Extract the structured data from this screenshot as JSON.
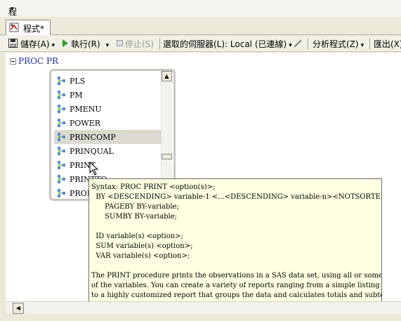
{
  "menu": {
    "label": "程式",
    "caret": "▾"
  },
  "tab": {
    "label": "程式*"
  },
  "toolbar": {
    "save": "儲存(A)",
    "run": "執行(R)",
    "stop": "停止(S)",
    "server": "選取的伺服器(L): Local (已連線)",
    "analyze": "分析程式(Z)",
    "export": "匯出(X)"
  },
  "editor": {
    "code": "PROC PR"
  },
  "autocomplete": {
    "items": [
      {
        "label": "PLS"
      },
      {
        "label": "PM"
      },
      {
        "label": "PMENU"
      },
      {
        "label": "POWER"
      },
      {
        "label": "PRINCOMP",
        "selected": true
      },
      {
        "label": "PRINQUAL"
      },
      {
        "label": "PRINT"
      },
      {
        "label": "PRINTTO"
      },
      {
        "label": "PROBIT"
      }
    ]
  },
  "tooltip": {
    "text": "Syntax: PROC PRINT <option(s)>;\n  BY <DESCENDING> variable-1 <...<DESCENDING> variable-n><NOTSORTED>;\n      PAGEBY BY-variable;\n      SUMBY BY-variable;\n\n  ID variable(s) <option>;\n  SUM variable(s) <option>;\n  VAR variable(s) <option>;\n\nThe PRINT procedure prints the observations in a SAS data set, using all or some\nof the variables. You can create a variety of reports ranging from a simple listing\nto a highly customized report that groups the data and calculates totals and subtotals\nfor numeric variables."
  },
  "colors": {
    "code": "#1f2fa8",
    "tooltip_bg": "#ffffe1",
    "selected_bg": "#dcd9d1"
  },
  "icons": {
    "proc_item": "procedure-icon",
    "save": "floppy-disk-icon",
    "run": "play-icon",
    "stop": "stop-square-icon",
    "server": "server-disconnect-icon"
  }
}
